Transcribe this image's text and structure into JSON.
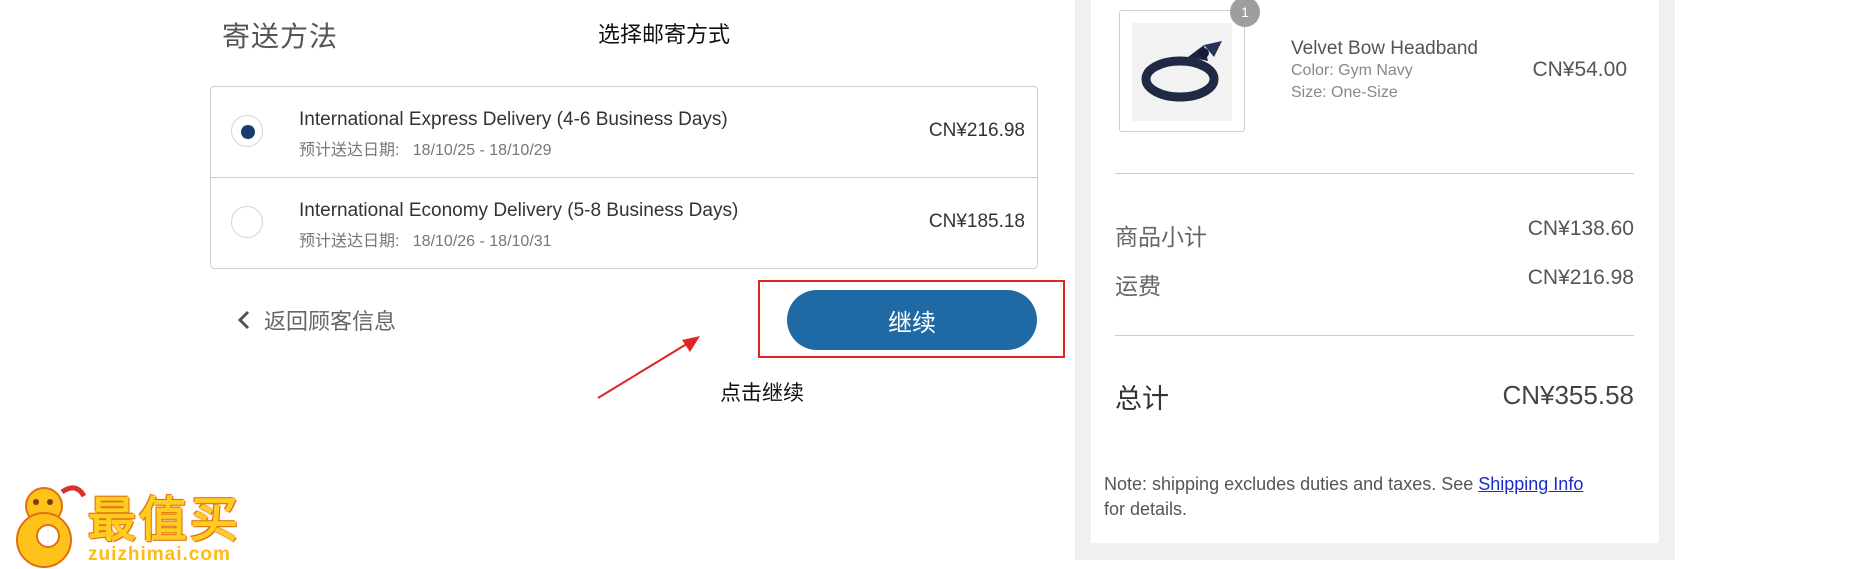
{
  "shipping": {
    "section_title": "寄送方法",
    "options": [
      {
        "name": "International Express Delivery (4-6 Business Days)",
        "date": "预计送达日期:   18/10/25 - 18/10/29",
        "price": "CN¥216.98",
        "selected": true
      },
      {
        "name": "International Economy Delivery (5-8 Business Days)",
        "date": "预计送达日期:   18/10/26 - 18/10/31",
        "price": "CN¥185.18",
        "selected": false
      }
    ],
    "back_label": "返回顾客信息",
    "continue_label": "继续"
  },
  "annotations": {
    "choose_shipping": "选择邮寄方式",
    "click_continue": "点击继续",
    "highlight_color": "#e02424"
  },
  "summary": {
    "item": {
      "quantity": "1",
      "name": "Velvet Bow Headband",
      "color": "Color: Gym Navy",
      "size": "Size: One-Size",
      "price": "CN¥54.00"
    },
    "subtotal_label": "商品小计",
    "subtotal_value": "CN¥138.60",
    "shipping_label": "运费",
    "shipping_value": "CN¥216.98",
    "total_label": "总计",
    "total_value": "CN¥355.58",
    "note_prefix": "Note: shipping excludes duties and taxes. See ",
    "note_link": "Shipping Info",
    "note_suffix": "for details."
  },
  "watermark": {
    "logo_text": "最值买",
    "domain": "zuizhimai.com"
  },
  "colors": {
    "button_blue": "#1f6aa5",
    "radio_selected": "#173d6b",
    "link": "#1a2bc9"
  }
}
